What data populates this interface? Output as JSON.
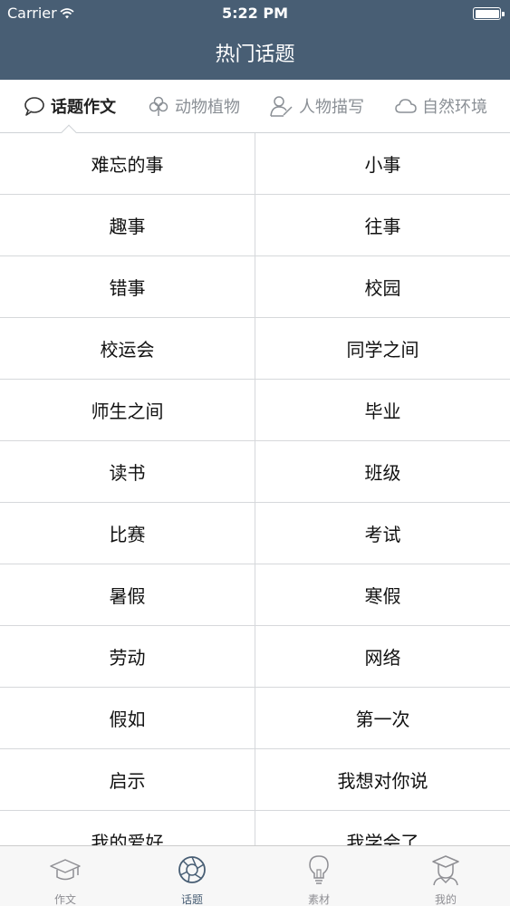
{
  "status_bar": {
    "carrier": "Carrier",
    "time": "5:22 PM"
  },
  "nav": {
    "title": "热门话题"
  },
  "tabs": [
    {
      "label": "话题作文",
      "icon": "speech-bubble-icon",
      "active": true
    },
    {
      "label": "动物植物",
      "icon": "clover-icon",
      "active": false
    },
    {
      "label": "人物描写",
      "icon": "person-pen-icon",
      "active": false
    },
    {
      "label": "自然环境",
      "icon": "cloud-icon",
      "active": false
    }
  ],
  "topics": [
    [
      "难忘的事",
      "小事"
    ],
    [
      "趣事",
      "往事"
    ],
    [
      "错事",
      "校园"
    ],
    [
      "校运会",
      "同学之间"
    ],
    [
      "师生之间",
      "毕业"
    ],
    [
      "读书",
      "班级"
    ],
    [
      "比赛",
      "考试"
    ],
    [
      "暑假",
      "寒假"
    ],
    [
      "劳动",
      "网络"
    ],
    [
      "假如",
      "第一次"
    ],
    [
      "启示",
      "我想对你说"
    ],
    [
      "我的爱好",
      "我学会了"
    ]
  ],
  "tabbar": [
    {
      "label": "作文",
      "icon": "graduation-cap-icon",
      "active": false
    },
    {
      "label": "话题",
      "icon": "aperture-icon",
      "active": true
    },
    {
      "label": "素材",
      "icon": "lightbulb-icon",
      "active": false
    },
    {
      "label": "我的",
      "icon": "student-avatar-icon",
      "active": false
    }
  ],
  "colors": {
    "header_bg": "#485e74",
    "active_tab": "#485e74",
    "divider": "#d6d8db"
  }
}
